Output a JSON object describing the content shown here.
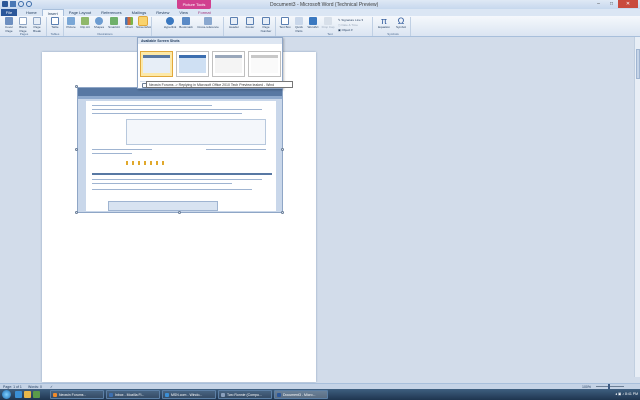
{
  "window": {
    "title": "Document3 - Microsoft Word (Technical Preview)",
    "contextual_tab_group": "Picture Tools"
  },
  "tabs": {
    "file": "File",
    "items": [
      "Home",
      "Insert",
      "Page Layout",
      "References",
      "Mailings",
      "Review",
      "View",
      "Format"
    ],
    "active": "Insert"
  },
  "ribbon": {
    "pages": {
      "cover": "Cover Page",
      "blank": "Blank Page",
      "break": "Page Break",
      "label": "Pages"
    },
    "tables": {
      "table": "Table",
      "label": "Tables"
    },
    "illustrations": {
      "picture": "Picture",
      "clipart": "Clip Art",
      "shapes": "Shapes",
      "smartart": "SmartArt",
      "chart": "Chart",
      "screenshot": "Screenshot",
      "label": "Illustrations"
    },
    "links": {
      "hyperlink": "Hyperlink",
      "bookmark": "Bookmark",
      "crossref": "Cross-reference"
    },
    "header_footer": {
      "header": "Header",
      "footer": "Footer",
      "page_number": "Page Number"
    },
    "text": {
      "textbox": "Text Box",
      "quickparts": "Quick Parts",
      "wordart": "WordArt",
      "dropcap": "Drop Cap",
      "signature": "Signature Line",
      "datetime": "Date & Time",
      "object": "Object",
      "label": "Text"
    },
    "symbols": {
      "equation": "Equation",
      "symbol": "Symbol",
      "label": "Symbols"
    }
  },
  "gallery": {
    "header": "Available Screen Shots",
    "clipping": "Screen Clipping",
    "tooltip": "Neowin Forums -> Replying in Microsoft Office 2010 Tech Preview leaked - Wind"
  },
  "status": {
    "page": "Page: 1 of 1",
    "words": "Words: 0",
    "zoom": "100%"
  },
  "taskbar": {
    "items": [
      "Neowin Forums -",
      "Inbox - Mozilla Fi...",
      "MSN.com - Windo...",
      "Two Ronnie (Compu...",
      "Document3 - Micro..."
    ],
    "active_index": 4,
    "time": "8:41 PM"
  },
  "colors": {
    "accent": "#2b579a",
    "picture_tools": "#d1408f",
    "highlight": "#f9d36d"
  }
}
